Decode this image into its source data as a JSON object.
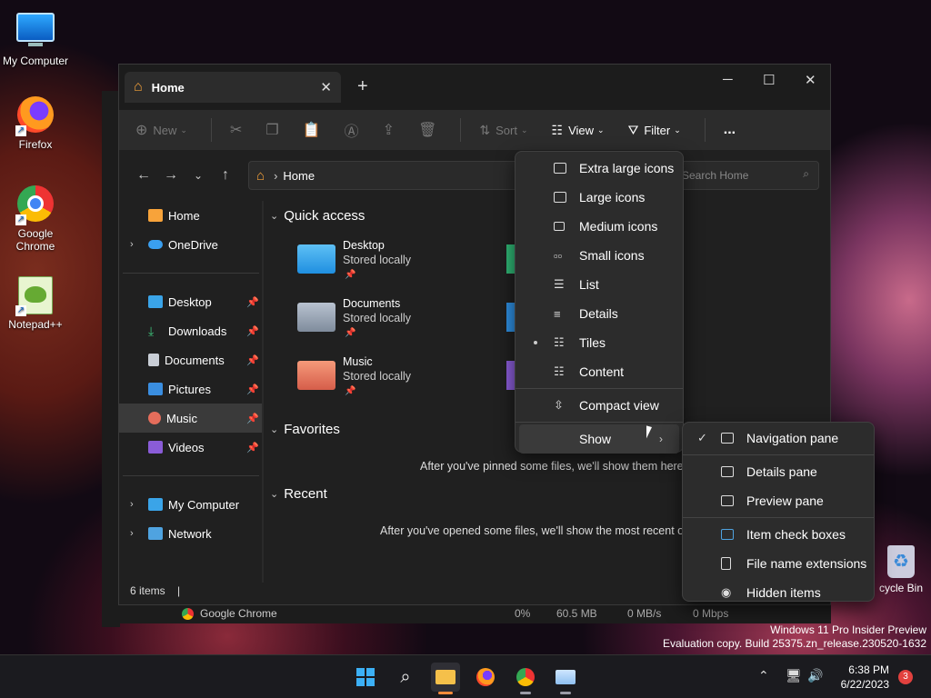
{
  "desktop": {
    "icons": [
      {
        "label": "My Computer"
      },
      {
        "label": "Firefox"
      },
      {
        "label": "Google Chrome"
      },
      {
        "label": "Notepad++"
      }
    ],
    "recycle_bin": "cycle Bin",
    "watermark_line1": "Windows 11 Pro Insider Preview",
    "watermark_line2": "Evaluation copy. Build 25375.zn_release.230520-1632"
  },
  "explorer": {
    "tab_title": "Home",
    "toolbar": {
      "new": "New",
      "sort": "Sort",
      "view": "View",
      "filter": "Filter",
      "more": "..."
    },
    "address": {
      "path": "Home"
    },
    "search": {
      "placeholder": "Search Home"
    },
    "nav": {
      "items": [
        {
          "label": "Home"
        },
        {
          "label": "OneDrive"
        },
        {
          "label": "Desktop"
        },
        {
          "label": "Downloads"
        },
        {
          "label": "Documents"
        },
        {
          "label": "Pictures"
        },
        {
          "label": "Music"
        },
        {
          "label": "Videos"
        },
        {
          "label": "My Computer"
        },
        {
          "label": "Network"
        }
      ]
    },
    "content": {
      "quick_access": "Quick access",
      "favorites": "Favorites",
      "recent": "Recent",
      "quick_items": [
        {
          "name": "Desktop",
          "sub": "Stored locally"
        },
        {
          "name": "Documents",
          "sub": "Stored locally"
        },
        {
          "name": "Music",
          "sub": "Stored locally"
        }
      ],
      "favorites_empty": "After you've pinned some files, we'll show them here.",
      "recent_empty": "After you've opened some files, we'll show the most recent one"
    },
    "status": {
      "count": "6 items"
    }
  },
  "view_menu": {
    "items": [
      {
        "label": "Extra large icons"
      },
      {
        "label": "Large icons"
      },
      {
        "label": "Medium icons"
      },
      {
        "label": "Small icons"
      },
      {
        "label": "List"
      },
      {
        "label": "Details"
      },
      {
        "label": "Tiles",
        "selected": true
      },
      {
        "label": "Content"
      },
      {
        "label": "Compact view"
      },
      {
        "label": "Show"
      }
    ]
  },
  "show_menu": {
    "items": [
      {
        "label": "Navigation pane",
        "checked": true
      },
      {
        "label": "Details pane"
      },
      {
        "label": "Preview pane"
      },
      {
        "label": "Item check boxes"
      },
      {
        "label": "File name extensions"
      },
      {
        "label": "Hidden items"
      }
    ]
  },
  "task_manager_row": {
    "name": "Google Chrome",
    "cpu": "0%",
    "memory": "60.5 MB",
    "disk": "0 MB/s",
    "network": "0 Mbps"
  },
  "taskbar": {
    "time": "6:38 PM",
    "date": "6/22/2023",
    "notifications": "3"
  }
}
